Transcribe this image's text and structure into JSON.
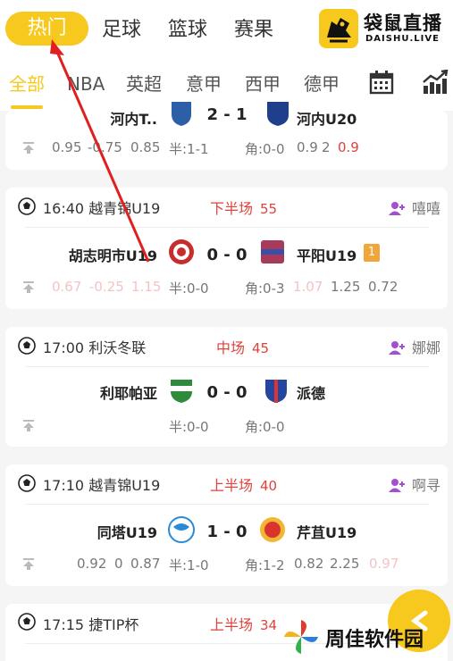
{
  "topnav": {
    "items": [
      "热门",
      "足球",
      "篮球",
      "赛果"
    ],
    "active_index": 0
  },
  "logo": {
    "title": "袋鼠直播",
    "subtitle": "DAISHU.LIVE"
  },
  "subnav": {
    "items": [
      "全部",
      "NBA",
      "英超",
      "意甲",
      "西甲",
      "德甲"
    ],
    "active_index": 0,
    "icons": [
      "calendar-icon",
      "bar-chart-icon"
    ]
  },
  "top_partial": {
    "home": "河内T..",
    "score": "2 - 1",
    "away": "河内U20",
    "odds": [
      "0.95",
      "-0.75",
      "0.85",
      "半:1-1",
      "角:0-0",
      "0.9",
      "2",
      "0.9"
    ]
  },
  "matches": [
    {
      "time": "16:40",
      "league": "越青锦U19",
      "status": "下半场",
      "minute": "55",
      "commentator": "嘻嘻",
      "home": "胡志明市U19",
      "score": "0 - 0",
      "away": "平阳U19",
      "badge": "1",
      "odds": [
        "0.67",
        "-0.25",
        "1.15",
        "半:0-0",
        "角:0-3",
        "1.07",
        "1.25",
        "0.72"
      ]
    },
    {
      "time": "17:00",
      "league": "利沃冬联",
      "status": "中场",
      "minute": "45",
      "commentator": "娜娜",
      "home": "利耶帕亚",
      "score": "0 - 0",
      "away": "派德",
      "odds": [
        "半:0-0",
        "角:0-0"
      ]
    },
    {
      "time": "17:10",
      "league": "越青锦U19",
      "status": "上半场",
      "minute": "40",
      "commentator": "啊寻",
      "home": "同塔U19",
      "score": "1 - 0",
      "away": "芹苴U19",
      "odds": [
        "0.92",
        "0",
        "0.87",
        "半:1-0",
        "角:1-2",
        "0.82",
        "2.25",
        "0.97"
      ]
    },
    {
      "time": "17:15",
      "league": "捷TIP杯",
      "status": "上半场",
      "minute": "34"
    }
  ],
  "watermark": {
    "text": "周佳软件园"
  },
  "colors": {
    "accent": "#f7c81d",
    "live_red": "#e0423c",
    "text": "#333333",
    "muted": "#777777"
  }
}
